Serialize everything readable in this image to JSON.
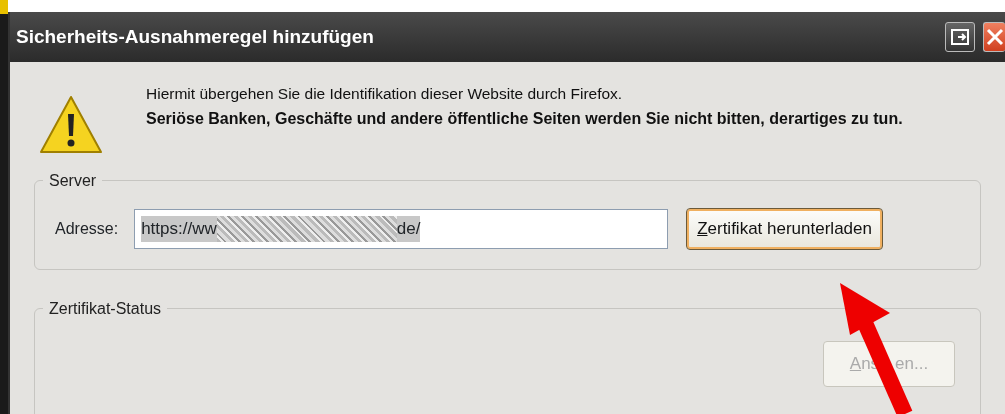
{
  "window": {
    "title": "Sicherheits-Ausnahmeregel hinzufügen"
  },
  "message": {
    "text": "Hiermit übergehen Sie die Identifikation dieser Website durch Firefox.",
    "warning": "Seriöse Banken, Geschäfte und andere öffentliche Seiten werden Sie nicht bitten, derartiges zu tun."
  },
  "server": {
    "legend": "Server",
    "address_label": "Adresse:",
    "address_start": "https://ww",
    "address_end": "de/",
    "download_button": {
      "label": "Zertifikat herunterladen",
      "focused": true
    }
  },
  "status": {
    "legend": "Zertifikat-Status",
    "view_button": {
      "label_start": "Ans",
      "label_end": "en...",
      "disabled": true
    }
  }
}
